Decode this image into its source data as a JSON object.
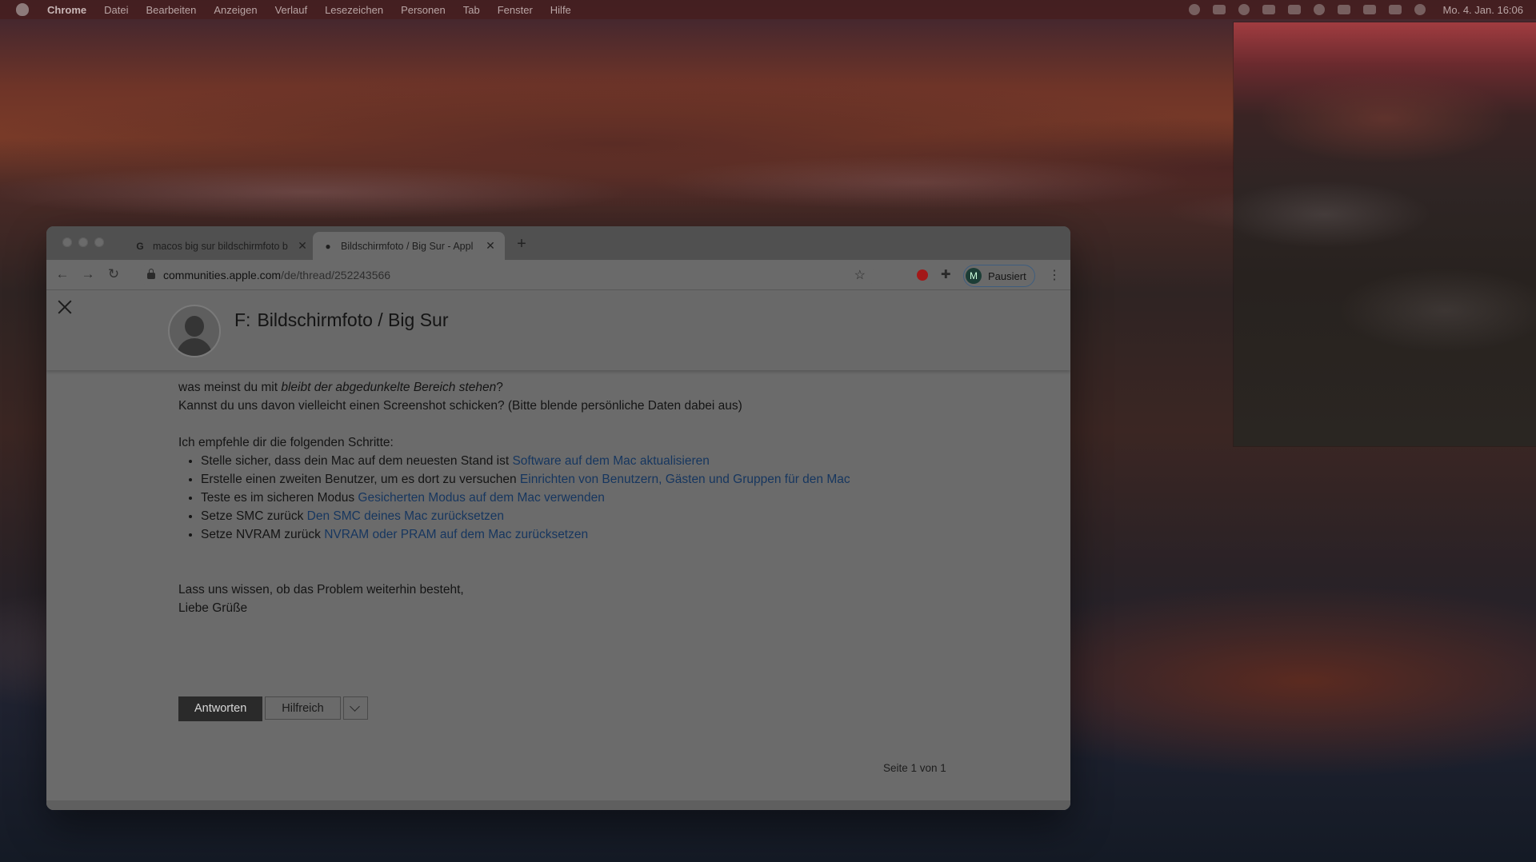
{
  "menubar": {
    "app": "Chrome",
    "items": [
      "Datei",
      "Bearbeiten",
      "Anzeigen",
      "Verlauf",
      "Lesezeichen",
      "Personen",
      "Tab",
      "Fenster",
      "Hilfe"
    ],
    "clock": "Mo. 4. Jan.  16:06"
  },
  "browser": {
    "tabs": [
      {
        "title": "macos big sur bildschirmfoto b",
        "favicon": "G",
        "active": false
      },
      {
        "title": "Bildschirmfoto / Big Sur - Appl",
        "favicon": "apple-icon",
        "active": true
      }
    ],
    "new_tab": "+",
    "url_host": "communities.apple.com",
    "url_path": "/de/thread/252243566",
    "profile": {
      "initial": "M",
      "label": "Pausiert"
    }
  },
  "page": {
    "question": {
      "prefix": "F:",
      "title": "Bildschirmfoto / Big Sur"
    },
    "reply": {
      "line1_prefix": "was meinst du mit ",
      "line1_em": "bleibt der abgedunkelte Bereich stehen",
      "line1_suffix": "?",
      "line2": "Kannst du uns davon vielleicht einen Screenshot schicken? (Bitte blende persönliche Daten dabei aus)",
      "steps_intro": "Ich empfehle dir die folgenden Schritte:",
      "steps": [
        {
          "text": "Stelle sicher, dass dein Mac auf dem neuesten Stand ist ",
          "link": "Software auf dem Mac aktualisieren"
        },
        {
          "text": "Erstelle einen zweiten Benutzer, um es dort zu versuchen ",
          "link": "Einrichten von Benutzern, Gästen und Gruppen für den Mac"
        },
        {
          "text": "Teste es im sicheren Modus ",
          "link": "Gesicherten Modus auf dem Mac verwenden"
        },
        {
          "text": "Setze SMC zurück ",
          "link": "Den SMC deines Mac zurücksetzen"
        },
        {
          "text": "Setze NVRAM zurück ",
          "link": "NVRAM oder PRAM auf dem Mac zurücksetzen"
        }
      ],
      "closing1": "Lass uns wissen, ob das Problem weiterhin besteht,",
      "closing2": "Liebe Grüße"
    },
    "buttons": {
      "reply": "Antworten",
      "helpful": "Hilfreich"
    },
    "pager": "Seite 1 von 1"
  }
}
